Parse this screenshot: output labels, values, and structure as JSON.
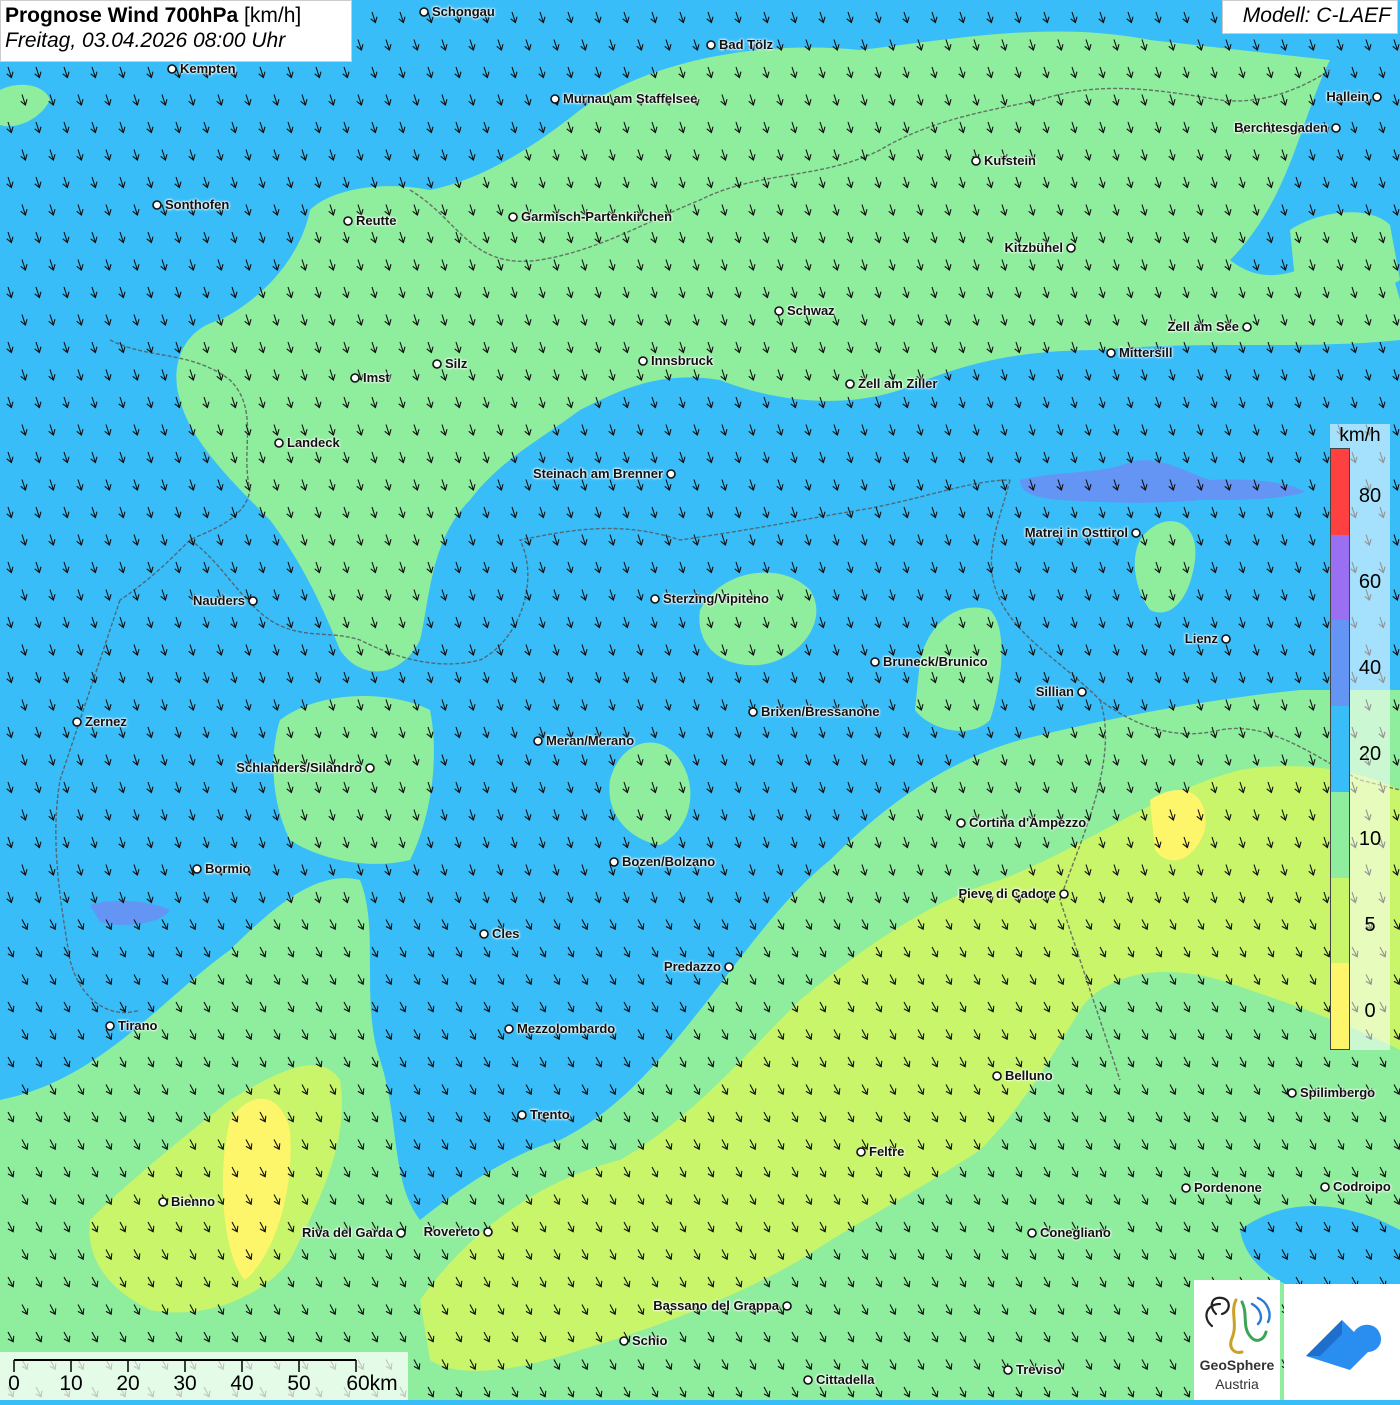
{
  "header": {
    "title_bold": "Prognose Wind 700hPa",
    "title_unit": "[km/h]",
    "datetime": "Freitag, 03.04.2026 08:00 Uhr",
    "model": "Modell: C-LAEF"
  },
  "legend": {
    "unit": "km/h",
    "colors": [
      "#ff4040",
      "#9b6ff2",
      "#6494f4",
      "#38bdf8",
      "#8fed9e",
      "#c8f56a",
      "#fdf56a"
    ],
    "labels": [
      "80",
      "60",
      "40",
      "20",
      "10",
      "5",
      "0"
    ]
  },
  "scalebar": {
    "labels": [
      "0",
      "10",
      "20",
      "30",
      "40",
      "50",
      "60km"
    ]
  },
  "logo": {
    "name": "GeoSphere",
    "sub": "Austria"
  },
  "cities": [
    {
      "name": "Schongau"
    },
    {
      "name": "Bad Tölz"
    },
    {
      "name": "Kempten"
    },
    {
      "name": "Murnau am Staffelsee"
    },
    {
      "name": "Hallein"
    },
    {
      "name": "Berchtesgaden"
    },
    {
      "name": "Kufstein"
    },
    {
      "name": "Sonthofen"
    },
    {
      "name": "Reutte"
    },
    {
      "name": "Garmisch-Partenkirchen"
    },
    {
      "name": "Kitzbühel"
    },
    {
      "name": "Schwaz"
    },
    {
      "name": "Zell am See"
    },
    {
      "name": "Mittersill"
    },
    {
      "name": "Innsbruck"
    },
    {
      "name": "Silz"
    },
    {
      "name": "Imst"
    },
    {
      "name": "Zell am Ziller"
    },
    {
      "name": "Landeck"
    },
    {
      "name": "Steinach am Brenner"
    },
    {
      "name": "Matrei in Osttirol"
    },
    {
      "name": "Nauders"
    },
    {
      "name": "Sterzing/Vipiteno"
    },
    {
      "name": "Lienz"
    },
    {
      "name": "Bruneck/Brunico"
    },
    {
      "name": "Sillian"
    },
    {
      "name": "Brixen/Bressanone"
    },
    {
      "name": "Zernez"
    },
    {
      "name": "Meran/Merano"
    },
    {
      "name": "Schlanders/Silandro"
    },
    {
      "name": "Cortina d'Ampezzo"
    },
    {
      "name": "Bormio"
    },
    {
      "name": "Bozen/Bolzano"
    },
    {
      "name": "Pieve di Cadore"
    },
    {
      "name": "Cles"
    },
    {
      "name": "Predazzo"
    },
    {
      "name": "Tirano"
    },
    {
      "name": "Mezzolombardo"
    },
    {
      "name": "Belluno"
    },
    {
      "name": "Spilimbergo"
    },
    {
      "name": "Trento"
    },
    {
      "name": "Feltre"
    },
    {
      "name": "Pordenone"
    },
    {
      "name": "Codroipo"
    },
    {
      "name": "Bienno"
    },
    {
      "name": "Riva del Garda"
    },
    {
      "name": "Rovereto"
    },
    {
      "name": "Conegliano"
    },
    {
      "name": "Bassano del Grappa"
    },
    {
      "name": "Schio"
    },
    {
      "name": "Cittadella"
    },
    {
      "name": "Treviso"
    }
  ]
}
